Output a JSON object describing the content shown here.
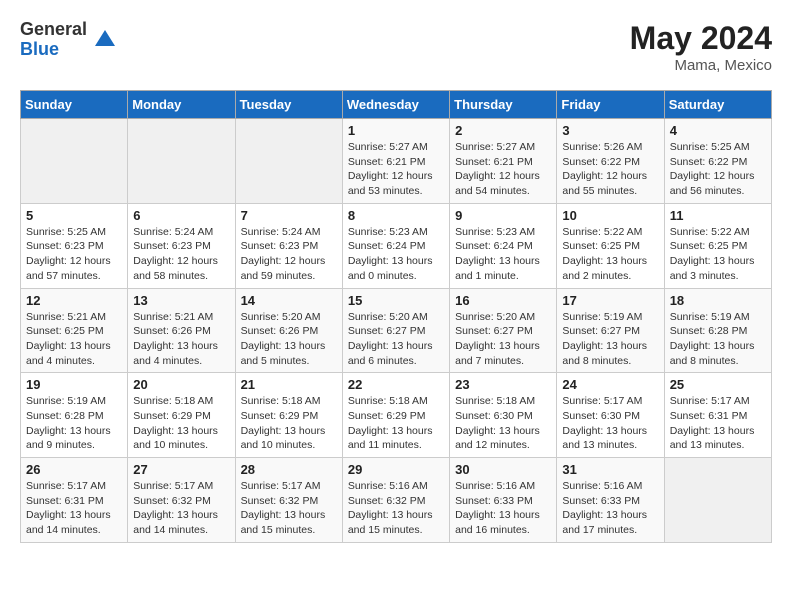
{
  "header": {
    "logo_general": "General",
    "logo_blue": "Blue",
    "month_year": "May 2024",
    "location": "Mama, Mexico"
  },
  "days_of_week": [
    "Sunday",
    "Monday",
    "Tuesday",
    "Wednesday",
    "Thursday",
    "Friday",
    "Saturday"
  ],
  "weeks": [
    [
      {
        "day": "",
        "sunrise": "",
        "sunset": "",
        "daylight": ""
      },
      {
        "day": "",
        "sunrise": "",
        "sunset": "",
        "daylight": ""
      },
      {
        "day": "",
        "sunrise": "",
        "sunset": "",
        "daylight": ""
      },
      {
        "day": "1",
        "sunrise": "Sunrise: 5:27 AM",
        "sunset": "Sunset: 6:21 PM",
        "daylight": "Daylight: 12 hours and 53 minutes."
      },
      {
        "day": "2",
        "sunrise": "Sunrise: 5:27 AM",
        "sunset": "Sunset: 6:21 PM",
        "daylight": "Daylight: 12 hours and 54 minutes."
      },
      {
        "day": "3",
        "sunrise": "Sunrise: 5:26 AM",
        "sunset": "Sunset: 6:22 PM",
        "daylight": "Daylight: 12 hours and 55 minutes."
      },
      {
        "day": "4",
        "sunrise": "Sunrise: 5:25 AM",
        "sunset": "Sunset: 6:22 PM",
        "daylight": "Daylight: 12 hours and 56 minutes."
      }
    ],
    [
      {
        "day": "5",
        "sunrise": "Sunrise: 5:25 AM",
        "sunset": "Sunset: 6:23 PM",
        "daylight": "Daylight: 12 hours and 57 minutes."
      },
      {
        "day": "6",
        "sunrise": "Sunrise: 5:24 AM",
        "sunset": "Sunset: 6:23 PM",
        "daylight": "Daylight: 12 hours and 58 minutes."
      },
      {
        "day": "7",
        "sunrise": "Sunrise: 5:24 AM",
        "sunset": "Sunset: 6:23 PM",
        "daylight": "Daylight: 12 hours and 59 minutes."
      },
      {
        "day": "8",
        "sunrise": "Sunrise: 5:23 AM",
        "sunset": "Sunset: 6:24 PM",
        "daylight": "Daylight: 13 hours and 0 minutes."
      },
      {
        "day": "9",
        "sunrise": "Sunrise: 5:23 AM",
        "sunset": "Sunset: 6:24 PM",
        "daylight": "Daylight: 13 hours and 1 minute."
      },
      {
        "day": "10",
        "sunrise": "Sunrise: 5:22 AM",
        "sunset": "Sunset: 6:25 PM",
        "daylight": "Daylight: 13 hours and 2 minutes."
      },
      {
        "day": "11",
        "sunrise": "Sunrise: 5:22 AM",
        "sunset": "Sunset: 6:25 PM",
        "daylight": "Daylight: 13 hours and 3 minutes."
      }
    ],
    [
      {
        "day": "12",
        "sunrise": "Sunrise: 5:21 AM",
        "sunset": "Sunset: 6:25 PM",
        "daylight": "Daylight: 13 hours and 4 minutes."
      },
      {
        "day": "13",
        "sunrise": "Sunrise: 5:21 AM",
        "sunset": "Sunset: 6:26 PM",
        "daylight": "Daylight: 13 hours and 4 minutes."
      },
      {
        "day": "14",
        "sunrise": "Sunrise: 5:20 AM",
        "sunset": "Sunset: 6:26 PM",
        "daylight": "Daylight: 13 hours and 5 minutes."
      },
      {
        "day": "15",
        "sunrise": "Sunrise: 5:20 AM",
        "sunset": "Sunset: 6:27 PM",
        "daylight": "Daylight: 13 hours and 6 minutes."
      },
      {
        "day": "16",
        "sunrise": "Sunrise: 5:20 AM",
        "sunset": "Sunset: 6:27 PM",
        "daylight": "Daylight: 13 hours and 7 minutes."
      },
      {
        "day": "17",
        "sunrise": "Sunrise: 5:19 AM",
        "sunset": "Sunset: 6:27 PM",
        "daylight": "Daylight: 13 hours and 8 minutes."
      },
      {
        "day": "18",
        "sunrise": "Sunrise: 5:19 AM",
        "sunset": "Sunset: 6:28 PM",
        "daylight": "Daylight: 13 hours and 8 minutes."
      }
    ],
    [
      {
        "day": "19",
        "sunrise": "Sunrise: 5:19 AM",
        "sunset": "Sunset: 6:28 PM",
        "daylight": "Daylight: 13 hours and 9 minutes."
      },
      {
        "day": "20",
        "sunrise": "Sunrise: 5:18 AM",
        "sunset": "Sunset: 6:29 PM",
        "daylight": "Daylight: 13 hours and 10 minutes."
      },
      {
        "day": "21",
        "sunrise": "Sunrise: 5:18 AM",
        "sunset": "Sunset: 6:29 PM",
        "daylight": "Daylight: 13 hours and 10 minutes."
      },
      {
        "day": "22",
        "sunrise": "Sunrise: 5:18 AM",
        "sunset": "Sunset: 6:29 PM",
        "daylight": "Daylight: 13 hours and 11 minutes."
      },
      {
        "day": "23",
        "sunrise": "Sunrise: 5:18 AM",
        "sunset": "Sunset: 6:30 PM",
        "daylight": "Daylight: 13 hours and 12 minutes."
      },
      {
        "day": "24",
        "sunrise": "Sunrise: 5:17 AM",
        "sunset": "Sunset: 6:30 PM",
        "daylight": "Daylight: 13 hours and 13 minutes."
      },
      {
        "day": "25",
        "sunrise": "Sunrise: 5:17 AM",
        "sunset": "Sunset: 6:31 PM",
        "daylight": "Daylight: 13 hours and 13 minutes."
      }
    ],
    [
      {
        "day": "26",
        "sunrise": "Sunrise: 5:17 AM",
        "sunset": "Sunset: 6:31 PM",
        "daylight": "Daylight: 13 hours and 14 minutes."
      },
      {
        "day": "27",
        "sunrise": "Sunrise: 5:17 AM",
        "sunset": "Sunset: 6:32 PM",
        "daylight": "Daylight: 13 hours and 14 minutes."
      },
      {
        "day": "28",
        "sunrise": "Sunrise: 5:17 AM",
        "sunset": "Sunset: 6:32 PM",
        "daylight": "Daylight: 13 hours and 15 minutes."
      },
      {
        "day": "29",
        "sunrise": "Sunrise: 5:16 AM",
        "sunset": "Sunset: 6:32 PM",
        "daylight": "Daylight: 13 hours and 15 minutes."
      },
      {
        "day": "30",
        "sunrise": "Sunrise: 5:16 AM",
        "sunset": "Sunset: 6:33 PM",
        "daylight": "Daylight: 13 hours and 16 minutes."
      },
      {
        "day": "31",
        "sunrise": "Sunrise: 5:16 AM",
        "sunset": "Sunset: 6:33 PM",
        "daylight": "Daylight: 13 hours and 17 minutes."
      },
      {
        "day": "",
        "sunrise": "",
        "sunset": "",
        "daylight": ""
      }
    ]
  ]
}
